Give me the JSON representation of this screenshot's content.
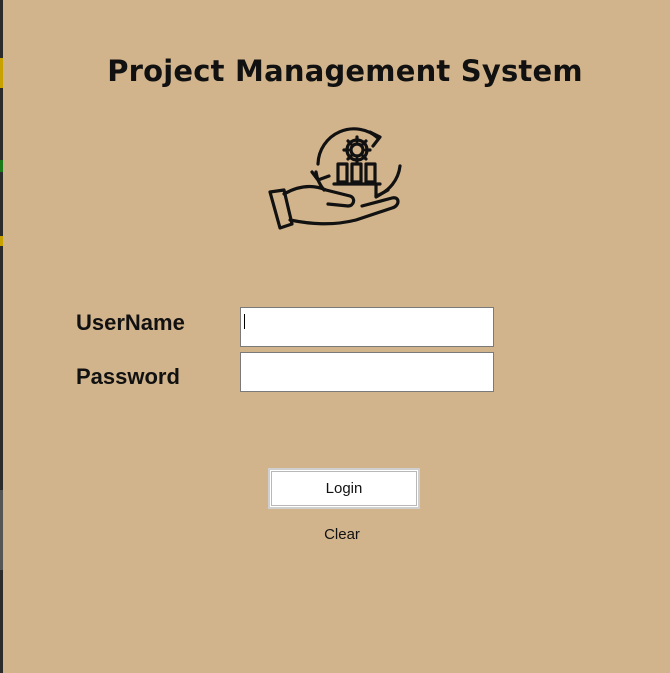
{
  "app": {
    "title": "Project Management System",
    "background_color": "#d2b48c"
  },
  "logo": {
    "icon": "project-management-icon"
  },
  "form": {
    "username_label": "UserName",
    "username_value": "",
    "password_label": "Password",
    "password_value": ""
  },
  "actions": {
    "login_label": "Login",
    "clear_label": "Clear"
  }
}
